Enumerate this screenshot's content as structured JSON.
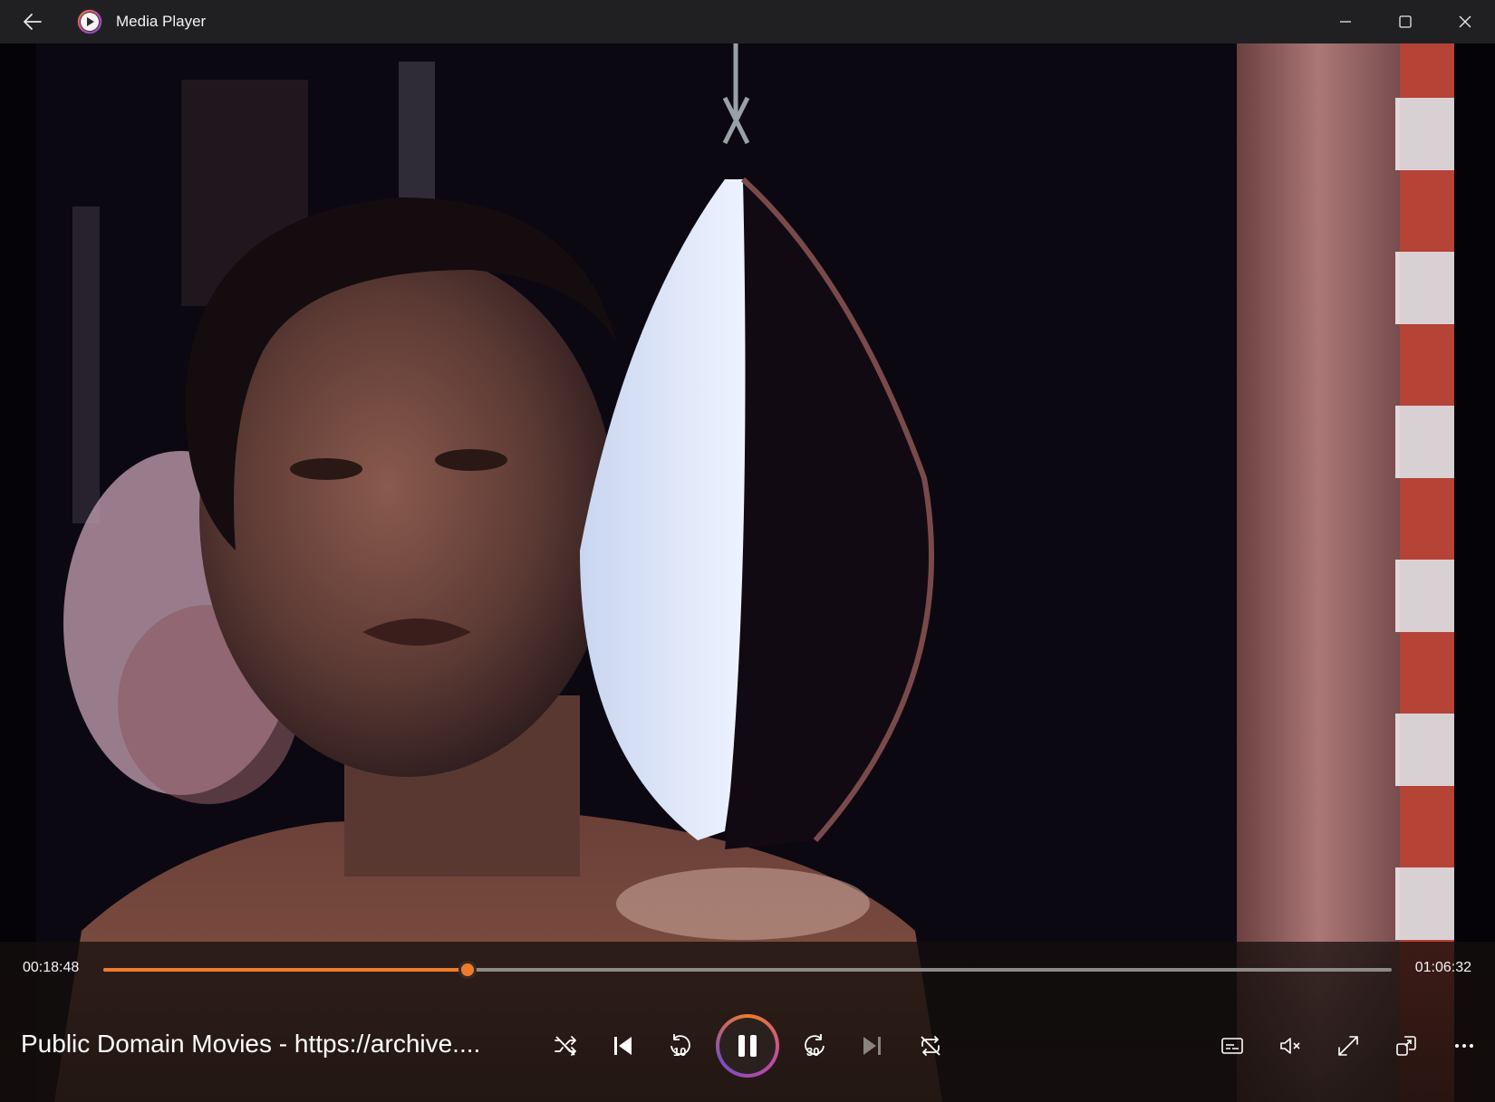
{
  "window": {
    "title": "Media Player"
  },
  "player": {
    "elapsed": "00:18:48",
    "duration": "01:06:32",
    "progress": 0.2826,
    "now_playing": "Public Domain Movies - https://archive...."
  },
  "icons": {
    "back": "arrow-left-icon",
    "app": "media-player-icon",
    "minimize": "minimize-icon",
    "maximize": "maximize-icon",
    "close": "close-icon",
    "shuffle": "shuffle-off-icon",
    "previous": "skip-previous-icon",
    "rewind": "rewind-10-icon",
    "pause": "pause-icon",
    "forward": "forward-30-icon",
    "next": "skip-next-icon",
    "repeat": "repeat-off-icon",
    "captions": "captions-icon",
    "volume": "volume-mute-icon",
    "fullscreen": "fullscreen-icon",
    "miniplayer": "miniplayer-icon",
    "more": "more-options-icon"
  },
  "labels": {
    "rewind_seconds": "10",
    "forward_seconds": "30"
  },
  "colors": {
    "accent": "#f07b2c",
    "titlebar": "#202022"
  }
}
